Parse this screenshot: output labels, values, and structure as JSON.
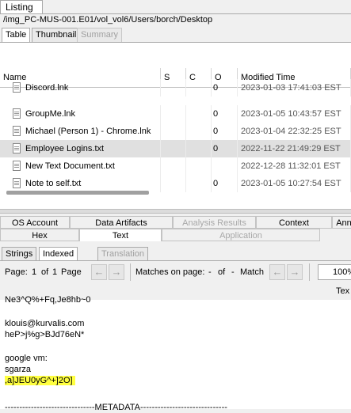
{
  "listing_tab": "Listing",
  "path": "/img_PC-MUS-001.E01/vol_vol6/Users/borch/Desktop",
  "view_tabs": [
    "Table",
    "Thumbnail",
    "Summary"
  ],
  "columns": [
    "Name",
    "S",
    "C",
    "O",
    "Modified Time"
  ],
  "rows": [
    {
      "name": "Discord.lnk",
      "o": "0",
      "modified": "2023-01-03 17:41:03 EST",
      "selected": false
    },
    {
      "name": "GroupMe.lnk",
      "o": "0",
      "modified": "2023-01-05 10:43:57 EST",
      "selected": false
    },
    {
      "name": "Michael (Person 1) - Chrome.lnk",
      "o": "0",
      "modified": "2023-01-04 22:32:25 EST",
      "selected": false
    },
    {
      "name": "Employee Logins.txt",
      "o": "0",
      "modified": "2022-11-22 21:49:29 EST",
      "selected": true
    },
    {
      "name": "New Text Document.txt",
      "o": "",
      "modified": "2022-12-28 11:32:01 EST",
      "selected": false
    },
    {
      "name": "Note to self.txt",
      "o": "0",
      "modified": "2023-01-05 10:27:54 EST",
      "selected": false
    }
  ],
  "lower_tabs_row1": [
    "OS Account",
    "Data Artifacts",
    "Analysis Results",
    "Context",
    "Ann"
  ],
  "lower_tabs_row2": [
    "Hex",
    "Text",
    "Application"
  ],
  "inner_tabs": [
    "Strings",
    "Indexed Text",
    "Translation"
  ],
  "toolbar": {
    "page_label": "Page:",
    "page_current": "1",
    "page_of": "of",
    "page_total": "1",
    "page_word": "Page",
    "matches_label": "Matches on page:",
    "matches_current": "-",
    "matches_of": "of",
    "matches_total": "-",
    "match_word": "Match",
    "zoom": "100%",
    "tex_label": "Tex"
  },
  "text_lines": [
    "Ne3^Q%+Fq,Je8hb~0",
    "",
    "klouis@kurvalis.com",
    "heP>j%g>BJd76eN*",
    "",
    "google vm:",
    "sgarza",
    ",a]JEU0yG^+]2O]",
    "",
    "-------------------------------METADATA------------------------------"
  ],
  "highlight_line_index": 7,
  "colors": {
    "highlight": "#ffff40",
    "selected_row": "#e0e0e0"
  }
}
